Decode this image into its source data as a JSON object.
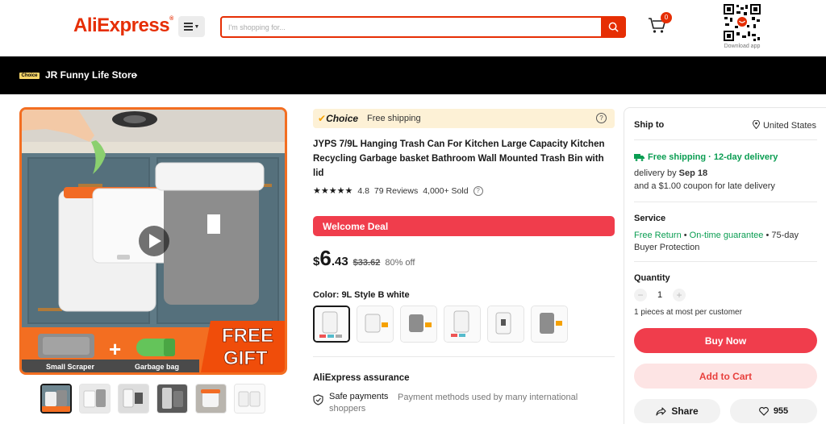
{
  "header": {
    "logo": "AliExpress",
    "search_placeholder": "I'm shopping for...",
    "cart_count": "0",
    "download_label": "Download app"
  },
  "store": {
    "badge": "Choice",
    "name": "JR Funny Life Store"
  },
  "gallery": {
    "scraper_label": "Small Scraper",
    "bag_label": "Garbage bag",
    "gift_line1": "FREE",
    "gift_line2": "GIFT",
    "thumb_count": 6
  },
  "product": {
    "choice_label": "Choice",
    "choice_shipping": "Free shipping",
    "title": "JYPS 7/9L Hanging Trash Can For Kitchen Large Capacity Kitchen Recycling Garbage basket Bathroom Wall Mounted Trash Bin with lid",
    "rating": "4.8",
    "reviews": "79 Reviews",
    "sold": "4,000+ Sold",
    "deal_label": "Welcome Deal",
    "price_currency": "$",
    "price_whole": "6",
    "price_cents": ".43",
    "price_old": "$33.62",
    "discount": "80% off",
    "color_label": "Color: 9L Style B white",
    "swatch_count": 6
  },
  "assurance": {
    "title": "AliExpress assurance",
    "item_label": "Safe payments",
    "item_desc": "Payment methods used by many international",
    "item_desc2": "shoppers"
  },
  "panel": {
    "ship_to_label": "Ship to",
    "ship_to_value": "United States",
    "free_shipping": "Free shipping · 12-day delivery",
    "delivery_prefix": "delivery by ",
    "delivery_date": "Sep 18",
    "delivery_coupon": "and a $1.00 coupon for late delivery",
    "service_title": "Service",
    "service_free_return": "Free Return",
    "service_sep1": " • ",
    "service_on_time": "On-time guarantee",
    "service_rest": " • 75-day Buyer Protection",
    "qty_title": "Quantity",
    "qty_value": "1",
    "qty_note": "1 pieces at most per customer",
    "buy_now": "Buy Now",
    "add_to_cart": "Add to Cart",
    "share": "Share",
    "wish_count": "955"
  },
  "colors": {
    "brand": "#e62e04",
    "deal_red": "#f03d4c",
    "green": "#0a9d52",
    "choice_bg": "#fdf1d6",
    "gallery_border": "#f36e21"
  }
}
